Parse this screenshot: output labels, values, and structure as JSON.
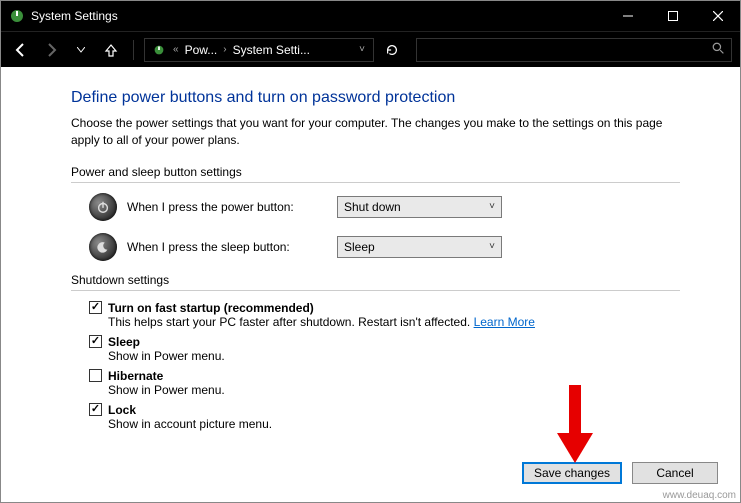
{
  "window": {
    "title": "System Settings"
  },
  "breadcrumb": {
    "seg1": "Pow...",
    "seg2": "System Setti..."
  },
  "page": {
    "title": "Define power buttons and turn on password protection",
    "description": "Choose the power settings that you want for your computer. The changes you make to the settings on this page apply to all of your power plans."
  },
  "group1": {
    "label": "Power and sleep button settings",
    "power_label": "When I press the power button:",
    "power_value": "Shut down",
    "sleep_label": "When I press the sleep button:",
    "sleep_value": "Sleep"
  },
  "group2": {
    "label": "Shutdown settings",
    "fast_startup": {
      "title": "Turn on fast startup (recommended)",
      "desc": "This helps start your PC faster after shutdown. Restart isn't affected. ",
      "link": "Learn More",
      "checked": true
    },
    "sleep": {
      "title": "Sleep",
      "desc": "Show in Power menu.",
      "checked": true
    },
    "hibernate": {
      "title": "Hibernate",
      "desc": "Show in Power menu.",
      "checked": false
    },
    "lock": {
      "title": "Lock",
      "desc": "Show in account picture menu.",
      "checked": true
    }
  },
  "buttons": {
    "save": "Save changes",
    "cancel": "Cancel"
  },
  "watermark": "www.deuaq.com"
}
